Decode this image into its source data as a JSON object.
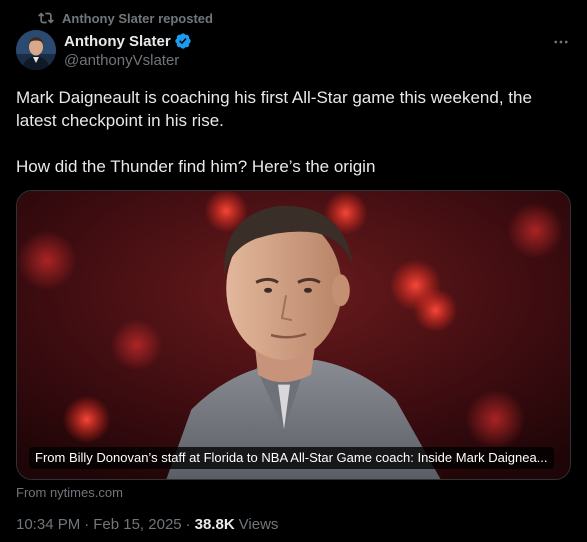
{
  "repost": {
    "label": "Anthony Slater reposted",
    "icon": "repost-icon"
  },
  "author": {
    "name": "Anthony Slater",
    "handle": "@anthonyVslater",
    "verified": true,
    "avatar_icon": "avatar"
  },
  "tweet": {
    "paragraph_1": "Mark Daigneault is coaching his first All-Star game this weekend, the latest checkpoint in his rise.",
    "paragraph_2": "How did the Thunder find him? Here’s the origin"
  },
  "card": {
    "title": "From Billy Donovan’s staff at Florida to NBA All-Star Game coach: Inside Mark Daignea...",
    "source": "From nytimes.com"
  },
  "meta": {
    "time": "10:34 PM",
    "separator": "·",
    "date": "Feb 15, 2025",
    "views_count": "38.8K",
    "views_label": "Views"
  },
  "colors": {
    "background": "#000000",
    "text": "#e7e9ea",
    "secondary": "#71767b",
    "verified": "#1d9bf0"
  }
}
